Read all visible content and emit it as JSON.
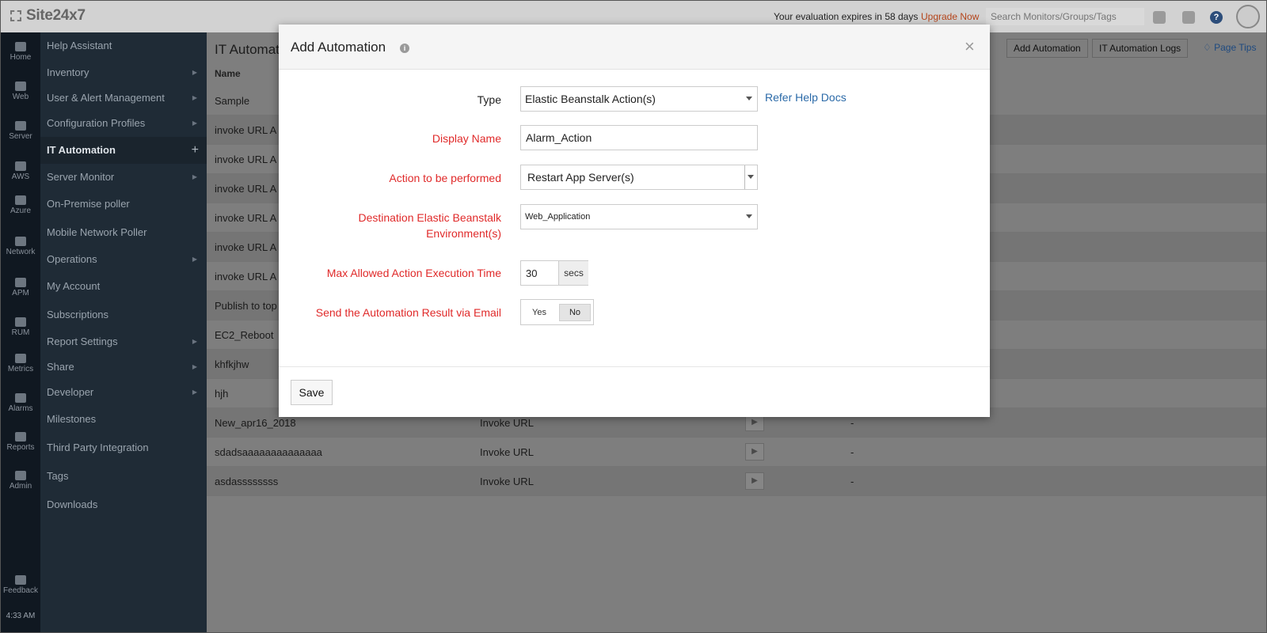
{
  "topbar": {
    "brand": "Site24x7",
    "eval_text": "Your evaluation expires in 58 days",
    "upgrade_label": "Upgrade Now",
    "search_placeholder": "Search Monitors/Groups/Tags"
  },
  "rail": {
    "items": [
      {
        "label": "Home",
        "icon": "home-icon"
      },
      {
        "label": "Web",
        "icon": "globe-icon"
      },
      {
        "label": "Server",
        "icon": "server-icon"
      },
      {
        "label": "AWS",
        "icon": "aws-icon"
      },
      {
        "label": "Azure",
        "icon": "azure-icon"
      },
      {
        "label": "Network",
        "icon": "network-icon"
      },
      {
        "label": "APM",
        "icon": "binoculars-icon"
      },
      {
        "label": "RUM",
        "icon": "rum-globe-icon"
      },
      {
        "label": "Metrics",
        "icon": "database-icon"
      },
      {
        "label": "Alarms",
        "icon": "bell-icon"
      },
      {
        "label": "Reports",
        "icon": "report-icon"
      },
      {
        "label": "Admin",
        "icon": "admin-icon"
      },
      {
        "label": "Feedback",
        "icon": "feedback-icon"
      }
    ],
    "time": "4:33 AM"
  },
  "menu": {
    "items": [
      {
        "label": "Help Assistant"
      },
      {
        "label": "Inventory"
      },
      {
        "label": "User & Alert Management"
      },
      {
        "label": "Configuration Profiles"
      },
      {
        "label": "IT Automation"
      },
      {
        "label": "Server Monitor"
      },
      {
        "label": "On-Premise poller"
      },
      {
        "label": "Mobile Network Poller"
      },
      {
        "label": "Operations"
      },
      {
        "label": "My Account"
      },
      {
        "label": "Subscriptions"
      },
      {
        "label": "Report Settings"
      },
      {
        "label": "Share"
      },
      {
        "label": "Developer"
      },
      {
        "label": "Milestones"
      },
      {
        "label": "Third Party Integration"
      },
      {
        "label": "Tags"
      },
      {
        "label": "Downloads"
      }
    ]
  },
  "main": {
    "page_title": "IT Automat",
    "add_automation_label": "Add Automation",
    "logs_label": "IT Automation Logs",
    "page_tips_label": "Page Tips",
    "col_name": "Name",
    "rows": [
      {
        "name": "Sample",
        "type": "",
        "status": ""
      },
      {
        "name": "invoke URL A",
        "type": "",
        "status": ""
      },
      {
        "name": "invoke URL A",
        "type": "",
        "status": ""
      },
      {
        "name": "invoke URL A",
        "type": "",
        "status": ""
      },
      {
        "name": "invoke URL A",
        "type": "",
        "status": ""
      },
      {
        "name": "invoke URL A",
        "type": "",
        "status": ""
      },
      {
        "name": "invoke URL A",
        "type": "",
        "status": ""
      },
      {
        "name": "Publish to top",
        "type": "",
        "status": ""
      },
      {
        "name": "EC2_Reboot",
        "type": "",
        "status": ""
      },
      {
        "name": "khfkjhw",
        "type": "",
        "status": ""
      },
      {
        "name": "hjh",
        "type": "",
        "status": ""
      },
      {
        "name": "New_apr16_2018",
        "type": "Invoke URL",
        "status": "-"
      },
      {
        "name": "sdadsaaaaaaaaaaaaaa",
        "type": "Invoke URL",
        "status": "-"
      },
      {
        "name": "asdassssssss",
        "type": "Invoke URL",
        "status": "-"
      }
    ]
  },
  "modal": {
    "title": "Add Automation",
    "type_label": "Type",
    "type_value": "Elastic Beanstalk Action(s)",
    "help_link": "Refer Help Docs",
    "display_name_label": "Display Name",
    "display_name_value": "Alarm_Action",
    "action_label": "Action to be performed",
    "action_value": "Restart App Server(s)",
    "destination_label_1": "Destination Elastic Beanstalk",
    "destination_label_2": "Environment(s)",
    "destination_value": "Web_Application",
    "max_time_label": "Max Allowed Action Execution Time",
    "max_time_value": "30",
    "max_time_unit": "secs",
    "email_label": "Send the Automation Result via Email",
    "email_yes": "Yes",
    "email_no": "No",
    "save_label": "Save"
  }
}
